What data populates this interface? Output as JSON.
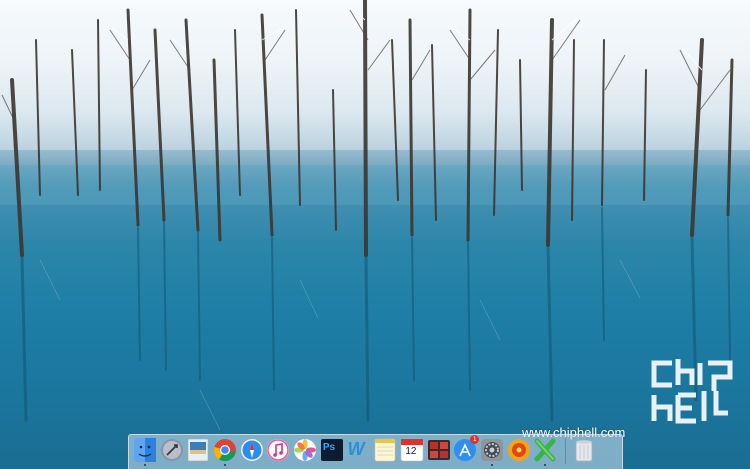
{
  "desktop": {
    "wallpaper": "frozen blue pond with snow-covered bare trees",
    "watermark_text": "www.chiphell.com",
    "logo_text": "chip hell"
  },
  "dock": {
    "items": [
      {
        "name": "Finder",
        "icon": "finder-icon",
        "running": true
      },
      {
        "name": "Launchpad",
        "icon": "launchpad-icon",
        "running": false
      },
      {
        "name": "Preview",
        "icon": "preview-icon",
        "running": false
      },
      {
        "name": "Google Chrome",
        "icon": "chrome-icon",
        "running": true
      },
      {
        "name": "Safari",
        "icon": "safari-icon",
        "running": false
      },
      {
        "name": "iTunes",
        "icon": "itunes-icon",
        "running": false
      },
      {
        "name": "Photos",
        "icon": "photos-icon",
        "running": false
      },
      {
        "name": "Photoshop",
        "icon": "photoshop-icon",
        "label": "Ps",
        "running": false
      },
      {
        "name": "Word",
        "icon": "word-icon",
        "label": "W",
        "running": false
      },
      {
        "name": "Notes",
        "icon": "notes-icon",
        "running": false
      },
      {
        "name": "Calendar",
        "icon": "calendar-icon",
        "day": "12",
        "running": false
      },
      {
        "name": "Photo Booth",
        "icon": "photobooth-icon",
        "running": false
      },
      {
        "name": "App Store",
        "icon": "appstore-icon",
        "badge": "1",
        "running": false
      },
      {
        "name": "System Preferences",
        "icon": "system-preferences-icon",
        "running": true
      },
      {
        "name": "Media Player",
        "icon": "media-player-icon",
        "running": false
      },
      {
        "name": "CrossOver",
        "icon": "crossover-icon",
        "running": true
      },
      {
        "name": "Trash",
        "icon": "trash-icon",
        "running": false
      }
    ]
  },
  "colors": {
    "pond_blue": "#1f7fa6",
    "snow": "#f4f8fb",
    "dock_glass": "#d2e4f0"
  }
}
